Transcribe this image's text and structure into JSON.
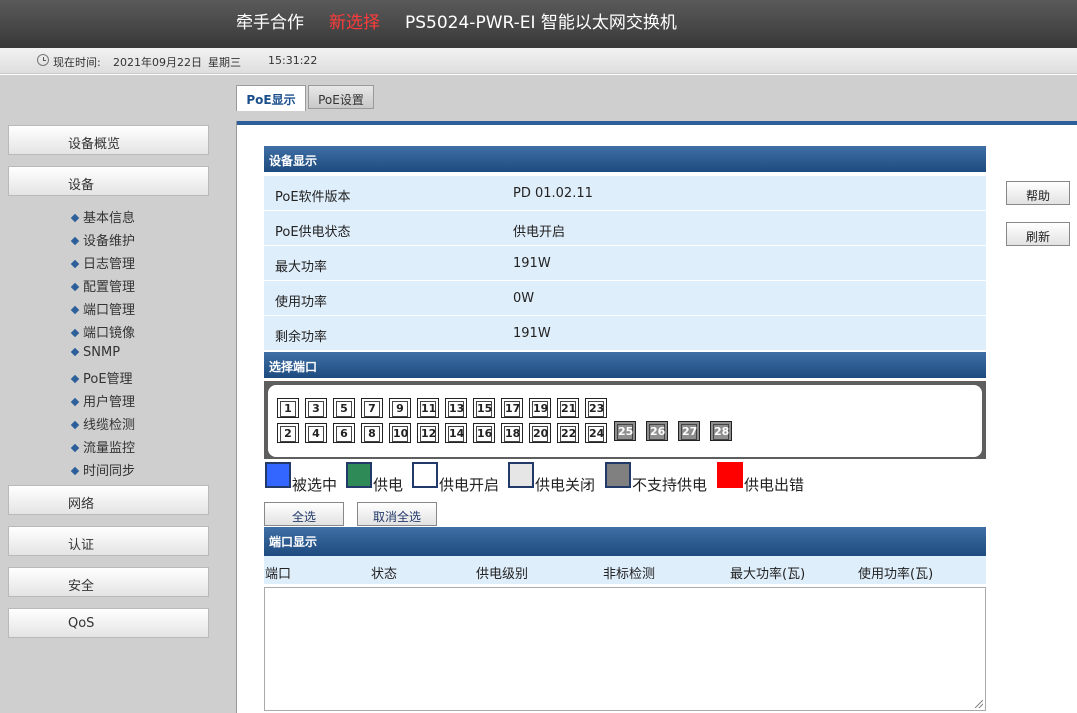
{
  "header": {
    "brand": "牵手合作",
    "brand_highlight": "新选择",
    "model": "PS5024-PWR-EI 智能以太网交换机"
  },
  "timebar": {
    "label": "现在时间:",
    "date": "2021年09月22日",
    "weekday": "星期三",
    "time": "15:31:22"
  },
  "sidebar": {
    "menus": [
      "设备概览",
      "设备"
    ],
    "sub_items": [
      "基本信息",
      "设备维护",
      "日志管理",
      "配置管理",
      "端口管理",
      "端口镜像",
      "SNMP",
      "PoE管理",
      "用户管理",
      "线缆检测",
      "流量监控",
      "时间同步"
    ],
    "menus_bottom": [
      "网络",
      "认证",
      "安全",
      "QoS"
    ]
  },
  "tabs": [
    "PoE显示",
    "PoE设置"
  ],
  "device_section": {
    "title": "设备显示"
  },
  "info": [
    {
      "key": "PoE软件版本",
      "value": "PD 01.02.11"
    },
    {
      "key": "PoE供电状态",
      "value": "供电开启"
    },
    {
      "key": "最大功率",
      "value": "191W"
    },
    {
      "key": "使用功率",
      "value": "0W"
    },
    {
      "key": "剩余功率",
      "value": "191W"
    }
  ],
  "port_section": {
    "title": "选择端口"
  },
  "ports_top": [
    "1",
    "3",
    "5",
    "7",
    "9",
    "11",
    "13",
    "15",
    "17",
    "19",
    "21",
    "23"
  ],
  "ports_bottom": [
    "2",
    "4",
    "6",
    "8",
    "10",
    "12",
    "14",
    "16",
    "18",
    "20",
    "22",
    "24"
  ],
  "ports_nosup": [
    "25",
    "26",
    "27",
    "28"
  ],
  "legend": [
    {
      "label": "被选中",
      "color": "#3366ff"
    },
    {
      "label": "供电",
      "color": "#2e8b57"
    },
    {
      "label": "供电开启",
      "color": "#ffffff"
    },
    {
      "label": "供电关闭",
      "color": "#e6e6e6"
    },
    {
      "label": "不支持供电",
      "color": "#808080"
    },
    {
      "label": "供电出错",
      "color": "#ff0000"
    }
  ],
  "buttons": {
    "select_all": "全选",
    "deselect_all": "取消全选",
    "help": "帮助",
    "refresh": "刷新"
  },
  "port_display": {
    "title": "端口显示"
  },
  "columns": [
    "端口",
    "状态",
    "供电级别",
    "非标检测",
    "最大功率(瓦)",
    "使用功率(瓦)"
  ]
}
